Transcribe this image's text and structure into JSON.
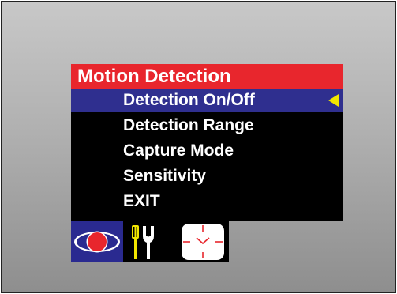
{
  "menu": {
    "title": "Motion Detection",
    "items": [
      {
        "label": "Detection On/Off",
        "selected": true
      },
      {
        "label": "Detection Range",
        "selected": false
      },
      {
        "label": "Capture Mode",
        "selected": false
      },
      {
        "label": "Sensitivity",
        "selected": false
      },
      {
        "label": "EXIT",
        "selected": false
      }
    ]
  },
  "tabs": [
    {
      "icon": "eye-icon",
      "active": true
    },
    {
      "icon": "tools-icon",
      "active": false
    },
    {
      "icon": "crosshair-clock-icon",
      "active": false
    }
  ],
  "colors": {
    "title_bar": "#e8262d",
    "selected_row": "#2f2f8f",
    "menu_background": "#000000",
    "arrow": "#f2e600",
    "text": "#ffffff",
    "active_tab": "#2a2a90"
  }
}
